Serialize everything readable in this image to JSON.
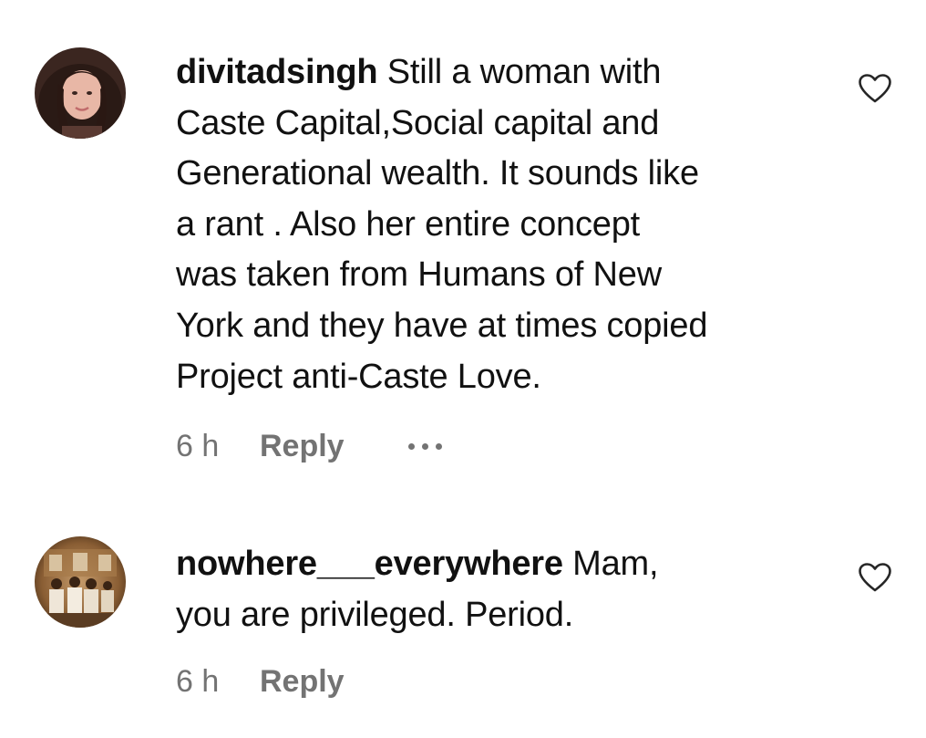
{
  "comments": [
    {
      "username": "divitadsingh",
      "lines": [
        "Still a woman with",
        "Caste Capital,Social capital and",
        "Generational wealth. It sounds like",
        "a rant . Also her entire concept",
        "was taken from Humans of New",
        "York and they have at times copied",
        "Project anti-Caste Love."
      ],
      "time": "6 h",
      "reply_label": "Reply",
      "avatar_icon": "avatar-woman-photo",
      "like_icon": "heart-outline-icon",
      "more_icon": "more-options-icon"
    },
    {
      "username": "nowhere___everywhere",
      "lines": [
        "Mam,",
        "you are privileged. Period."
      ],
      "time": "6 h",
      "reply_label": "Reply",
      "avatar_icon": "avatar-group-photo",
      "like_icon": "heart-outline-icon"
    }
  ],
  "colors": {
    "text": "#111111",
    "meta": "#737373",
    "background": "#ffffff"
  }
}
